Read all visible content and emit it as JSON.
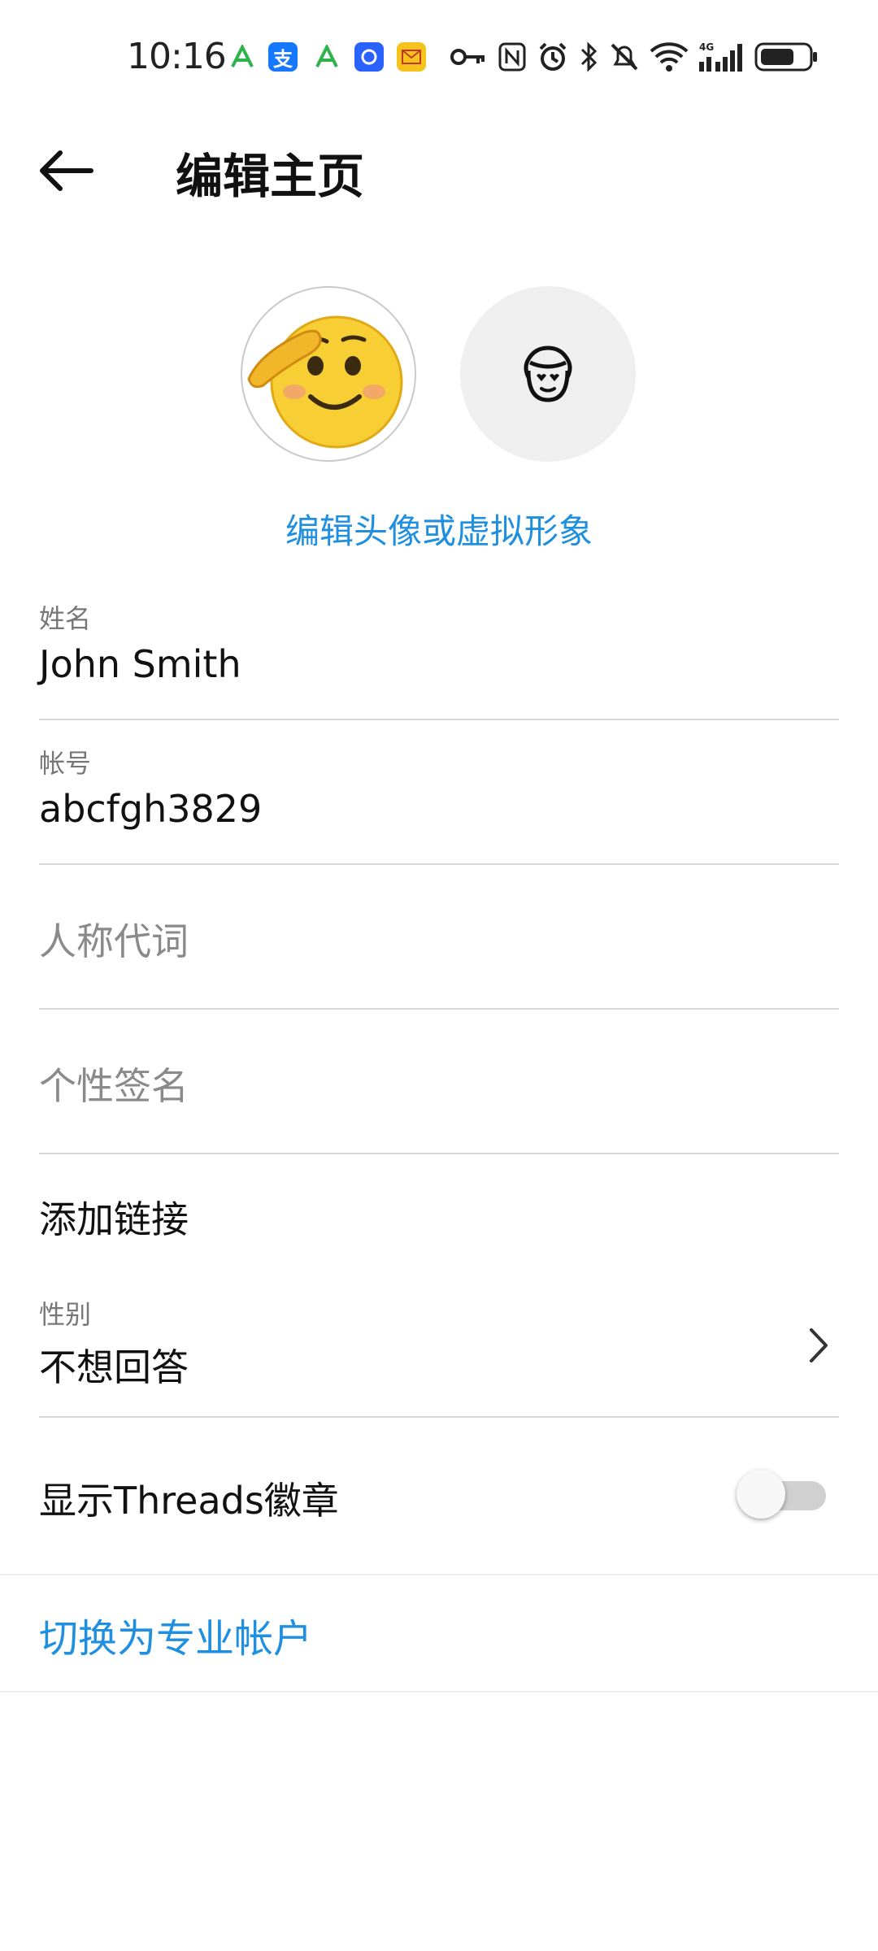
{
  "status_bar": {
    "time": "10:16",
    "notification_icons": [
      "a-green-icon",
      "alipay-icon",
      "a-green-icon",
      "blue-app-icon",
      "mail-icon"
    ],
    "system_icons": [
      "key-icon",
      "nfc-icon",
      "alarm-icon",
      "bluetooth-icon",
      "mute-icon",
      "wifi-icon",
      "signal-4g-icon",
      "battery-icon"
    ],
    "network": "4G",
    "alipay_char": "支"
  },
  "header": {
    "title": "编辑主页"
  },
  "avatar": {
    "edit_link": "编辑头像或虚拟形象"
  },
  "fields": {
    "name": {
      "label": "姓名",
      "value": "John Smith"
    },
    "username": {
      "label": "帐号",
      "value": "abcfgh3829"
    },
    "pronouns": {
      "placeholder": "人称代词"
    },
    "bio": {
      "placeholder": "个性签名"
    }
  },
  "add_link": "添加链接",
  "gender": {
    "label": "性别",
    "value": "不想回答"
  },
  "threads_badge": {
    "label": "显示Threads徽章",
    "enabled": false
  },
  "switch_professional": "切换为专业帐户",
  "colors": {
    "accent": "#1f8fe0",
    "divider": "#d9d9d9"
  }
}
